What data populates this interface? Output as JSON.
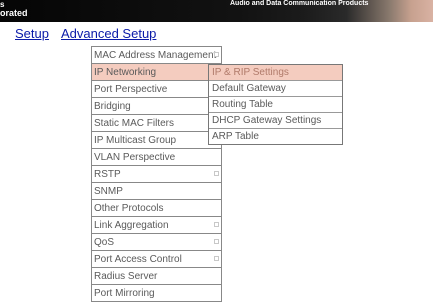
{
  "header": {
    "brand_line1": "s",
    "brand_line2": "orated",
    "tagline": "Audio and Data Communication Products",
    "accent_color": "#d9b2a3"
  },
  "nav": {
    "setup_label": "Setup",
    "advanced_label": "Advanced Setup"
  },
  "menu": {
    "items": [
      {
        "label": "MAC Address Management",
        "has_submenu": true
      },
      {
        "label": "IP Networking",
        "has_submenu": false,
        "active": true
      },
      {
        "label": "Port Perspective",
        "has_submenu": false
      },
      {
        "label": "Bridging",
        "has_submenu": false
      },
      {
        "label": "Static MAC Filters",
        "has_submenu": false
      },
      {
        "label": "IP Multicast Group",
        "has_submenu": false
      },
      {
        "label": "VLAN Perspective",
        "has_submenu": false
      },
      {
        "label": "RSTP",
        "has_submenu": true
      },
      {
        "label": "SNMP",
        "has_submenu": false
      },
      {
        "label": "Other Protocols",
        "has_submenu": false
      },
      {
        "label": "Link Aggregation",
        "has_submenu": true
      },
      {
        "label": "QoS",
        "has_submenu": true
      },
      {
        "label": "Port Access Control",
        "has_submenu": true
      },
      {
        "label": "Radius Server",
        "has_submenu": false
      },
      {
        "label": "Port Mirroring",
        "has_submenu": false
      }
    ]
  },
  "submenu": {
    "items": [
      {
        "label": "IP & RIP Settings",
        "active": true
      },
      {
        "label": "Default Gateway"
      },
      {
        "label": "Routing Table"
      },
      {
        "label": "DHCP Gateway Settings"
      },
      {
        "label": "ARP Table"
      }
    ]
  }
}
